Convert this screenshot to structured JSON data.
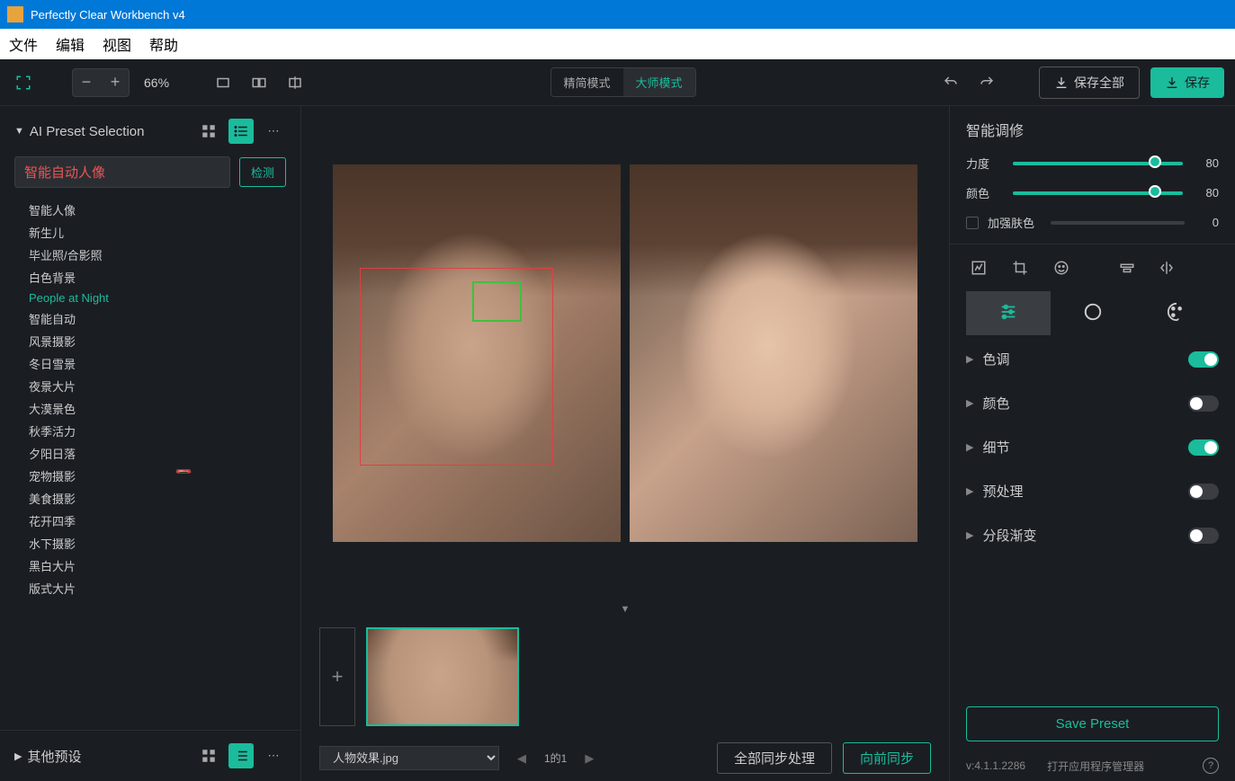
{
  "app": {
    "title": "Perfectly Clear Workbench v4"
  },
  "menu": {
    "file": "文件",
    "edit": "编辑",
    "view": "视图",
    "help": "帮助"
  },
  "toolbar": {
    "zoom": "66%",
    "mode_simple": "精简模式",
    "mode_master": "大师模式",
    "save_all": "保存全部",
    "save": "保存"
  },
  "left": {
    "title": "AI Preset Selection",
    "selected": "智能自动人像",
    "detect": "检测",
    "presets": [
      "智能人像",
      "新生儿",
      "毕业照/合影照",
      "白色背景",
      "People at Night",
      "智能自动",
      "风景摄影",
      "冬日雪景",
      "夜景大片",
      "大漠景色",
      "秋季活力",
      "夕阳日落",
      "宠物摄影",
      "美食摄影",
      "花开四季",
      "水下摄影",
      "黑白大片",
      "版式大片"
    ],
    "active_preset_index": 4,
    "other": "其他预设"
  },
  "center": {
    "filename": "人物效果.jpg",
    "page": "1的1",
    "sync_all": "全部同步处理",
    "sync_current": "向前同步"
  },
  "right": {
    "title": "智能调修",
    "sliders": [
      {
        "label": "力度",
        "value": 80
      },
      {
        "label": "颜色",
        "value": 80
      }
    ],
    "enhance_skin": "加强肤色",
    "enhance_skin_value": 0,
    "accordion": [
      {
        "label": "色调",
        "on": true
      },
      {
        "label": "颜色",
        "on": false
      },
      {
        "label": "细节",
        "on": true
      },
      {
        "label": "预处理",
        "on": false
      },
      {
        "label": "分段渐变",
        "on": false
      }
    ],
    "save_preset": "Save Preset",
    "version": "v:4.1.1.2286",
    "open_manager": "打开应用程序管理器"
  }
}
